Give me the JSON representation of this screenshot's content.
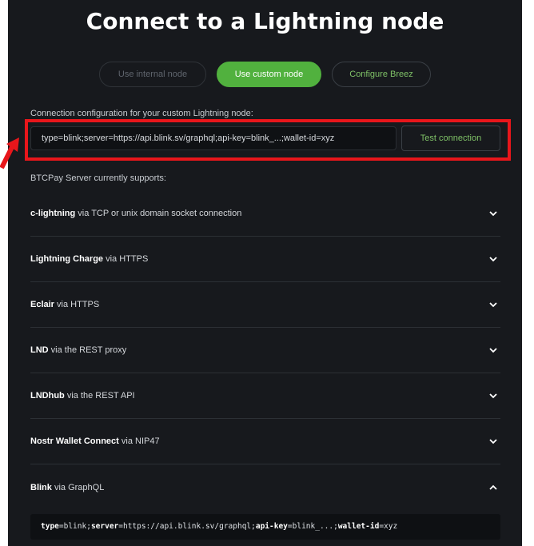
{
  "title": "Connect to a Lightning node",
  "node_options": {
    "internal": "Use internal node",
    "custom": "Use custom node",
    "breez": "Configure Breez"
  },
  "connection": {
    "label": "Connection configuration for your custom Lightning node:",
    "value": "type=blink;server=https://api.blink.sv/graphql;api-key=blink_...;wallet-id=xyz",
    "test_button": "Test connection"
  },
  "supports_label": "BTCPay Server currently supports:",
  "implementations": [
    {
      "name": "c-lightning",
      "via": " via TCP or unix domain socket connection",
      "expanded": false
    },
    {
      "name": "Lightning Charge",
      "via": " via HTTPS",
      "expanded": false
    },
    {
      "name": "Eclair",
      "via": " via HTTPS",
      "expanded": false
    },
    {
      "name": "LND",
      "via": " via the REST proxy",
      "expanded": false
    },
    {
      "name": "LNDhub",
      "via": " via the REST API",
      "expanded": false
    },
    {
      "name": "Nostr Wallet Connect",
      "via": " via NIP47",
      "expanded": false
    },
    {
      "name": "Blink",
      "via": " via GraphQL",
      "expanded": true
    }
  ],
  "blink_example": {
    "k1": "type",
    "v1": "=blink;",
    "k2": "server",
    "v2": "=https://api.blink.sv/graphql;",
    "k3": "api-key",
    "v3": "=blink_...;",
    "k4": "wallet-id",
    "v4": "=xyz"
  },
  "colors": {
    "background": "#17191d",
    "accent_green": "#51b13e",
    "highlight_red": "#e8161b"
  }
}
